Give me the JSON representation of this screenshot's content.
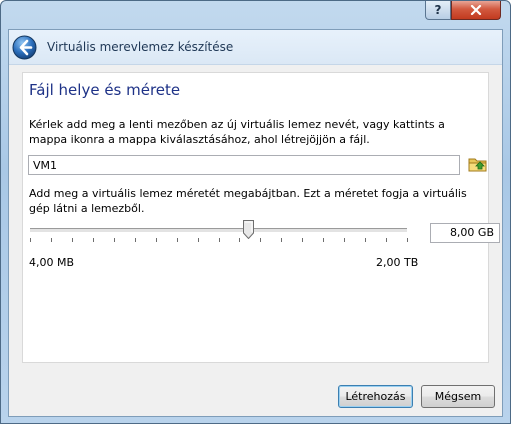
{
  "titlebar": {
    "help_label": "?"
  },
  "header": {
    "title": "Virtuális merevlemez készítése"
  },
  "page": {
    "title": "Fájl helye és mérete",
    "location_description": "Kérlek add meg a lenti mezőben az új virtuális lemez nevét, vagy kattints a mappa ikonra a mappa kiválasztásához, ahol létrejöjjön a fájl.",
    "file_name": "VM1",
    "size_description": "Add meg a virtuális lemez méretét megabájtban. Ezt a méretet fogja a virtuális gép látni a lemezből.",
    "size_value": "8,00 GB",
    "slider_fraction": 0.58,
    "min_label": "4,00 MB",
    "max_label": "2,00 TB"
  },
  "buttons": {
    "create": "Létrehozás",
    "cancel": "Mégsem"
  },
  "colors": {
    "title_blue": "#1e3287",
    "close_red": "#c23a1f"
  }
}
